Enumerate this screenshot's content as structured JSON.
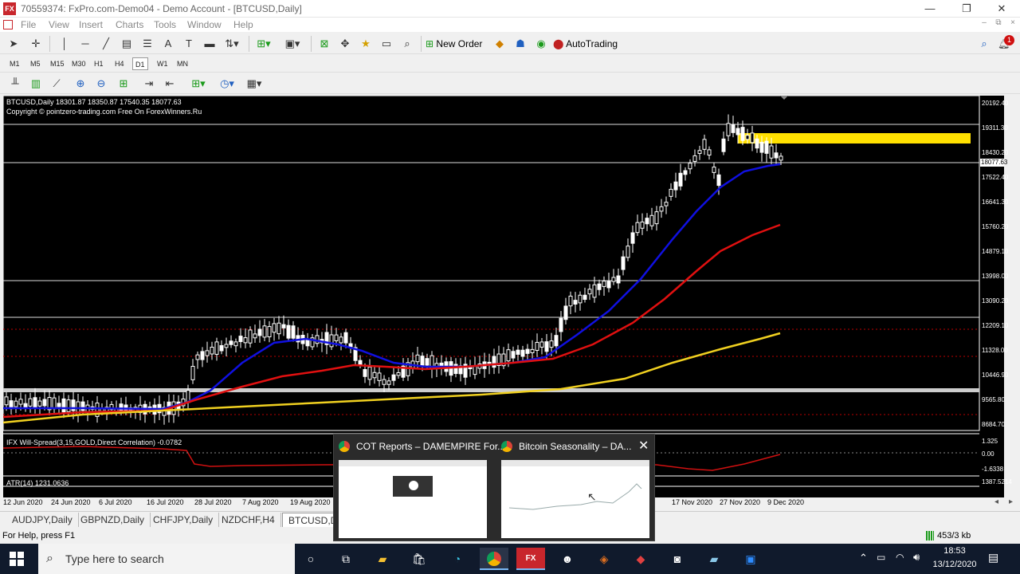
{
  "window": {
    "title": "70559374: FxPro.com-Demo04 - Demo Account - [BTCUSD,Daily]",
    "app_icon_text": "FX",
    "controls": [
      "—",
      "❐",
      "✕"
    ]
  },
  "menubar": {
    "items": [
      "File",
      "View",
      "Insert",
      "Charts",
      "Tools",
      "Window",
      "Help"
    ],
    "mdi_controls": [
      "–",
      "⧉",
      "×"
    ]
  },
  "toolbar": {
    "new_order_label": "New Order",
    "autotrading_label": "AutoTrading",
    "notification_count": "1"
  },
  "timeframes": {
    "items": [
      "M1",
      "M5",
      "M15",
      "M30",
      "H1",
      "H4",
      "D1",
      "W1",
      "MN"
    ],
    "active": "D1"
  },
  "chart": {
    "symbol_header": "BTCUSD,Daily  18301.87 18350.87 17540.35 18077.63",
    "copyright": "Copyright © pointzero-trading.com Free On ForexWinners.Ru",
    "price_labels": [
      "20192.40",
      "19311.30",
      "18430.20",
      "17522.40",
      "16641.30",
      "15760.20",
      "14879.10",
      "13998.00",
      "13090.20",
      "12209.10",
      "11328.00",
      "10446.90",
      "9565.80",
      "8684.70"
    ],
    "current_price": "18077.63",
    "date_labels": [
      "12 Jun 2020",
      "24 Jun 2020",
      "6 Jul 2020",
      "16 Jul 2020",
      "28 Jul 2020",
      "7 Aug 2020",
      "19 Aug 2020",
      "17 Nov 2020",
      "27 Nov 2020",
      "9 Dec 2020"
    ],
    "indicator1_label": "IFX Will-Spread(3,15,GOLD,Direct Correlation) -0.0782",
    "indicator1_scale": [
      "1.325",
      "0.00",
      "-1.6338"
    ],
    "indicator2_label": "ATR(14) 1231.0636",
    "indicator2_scale": "1387.5214",
    "colors": {
      "ma_fast": "#1010e0",
      "ma_mid": "#e01010",
      "ma_slow": "#f0d020",
      "zone": "#ffe000",
      "background": "#000000"
    }
  },
  "tabs": {
    "items": [
      "AUDJPY,Daily",
      "GBPNZD,Daily",
      "CHFJPY,Daily",
      "NZDCHF,H4",
      "BTCUSD,Da"
    ],
    "active": "BTCUSD,Da"
  },
  "statusbar": {
    "help": "For Help, press F1",
    "traffic": "453/3 kb"
  },
  "popup": {
    "thumb1_title": "COT Reports – DAMEMPIRE For...",
    "thumb2_title": "Bitcoin Seasonality – DA..."
  },
  "taskbar": {
    "search_placeholder": "Type here to search",
    "time": "18:53",
    "date": "13/12/2020"
  }
}
